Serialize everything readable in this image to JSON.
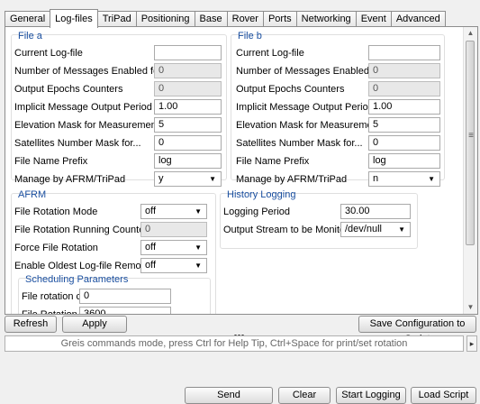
{
  "tabs": [
    "General",
    "Log-files",
    "TriPad",
    "Positioning",
    "Base",
    "Rover",
    "Ports",
    "Networking",
    "Event",
    "Advanced"
  ],
  "active_tab": "Log-files",
  "file_a": {
    "title": "File a",
    "rows": [
      {
        "label": "Current Log-file",
        "value": "",
        "kind": "field"
      },
      {
        "label": "Number of Messages Enabled for...",
        "value": "0",
        "kind": "ro"
      },
      {
        "label": "Output Epochs Counters",
        "value": "0",
        "kind": "ro"
      },
      {
        "label": "Implicit Message Output Period",
        "value": "1.00",
        "kind": "field"
      },
      {
        "label": "Elevation Mask for Measurements...",
        "value": "5",
        "kind": "field"
      },
      {
        "label": "Satellites Number Mask for...",
        "value": "0",
        "kind": "field"
      },
      {
        "label": "File Name Prefix",
        "value": "log",
        "kind": "field"
      },
      {
        "label": "Manage by AFRM/TriPad",
        "value": "y",
        "kind": "combo"
      }
    ]
  },
  "file_b": {
    "title": "File b",
    "rows": [
      {
        "label": "Current Log-file",
        "value": "",
        "kind": "field"
      },
      {
        "label": "Number of Messages Enabled for...",
        "value": "0",
        "kind": "ro"
      },
      {
        "label": "Output Epochs Counters",
        "value": "0",
        "kind": "ro"
      },
      {
        "label": "Implicit Message Output Period",
        "value": "1.00",
        "kind": "field"
      },
      {
        "label": "Elevation Mask for Measurements...",
        "value": "5",
        "kind": "field"
      },
      {
        "label": "Satellites Number Mask for...",
        "value": "0",
        "kind": "field"
      },
      {
        "label": "File Name Prefix",
        "value": "log",
        "kind": "field"
      },
      {
        "label": "Manage by AFRM/TriPad",
        "value": "n",
        "kind": "combo"
      }
    ]
  },
  "afrm": {
    "title": "AFRM",
    "rows": [
      {
        "label": "File Rotation Mode",
        "value": "off",
        "kind": "combo"
      },
      {
        "label": "File Rotation Running Counter",
        "value": "0",
        "kind": "ro"
      },
      {
        "label": "Force File Rotation",
        "value": "off",
        "kind": "combo"
      },
      {
        "label": "Enable Oldest Log-file Removal",
        "value": "off",
        "kind": "combo"
      }
    ],
    "scheduling": {
      "title": "Scheduling Parameters",
      "rows": [
        {
          "label": "File rotation counter",
          "value": "0"
        },
        {
          "label": "File Rotation Period",
          "value": "3600"
        }
      ]
    }
  },
  "history": {
    "title": "History Logging",
    "rows": [
      {
        "label": "Logging Period",
        "value": "30.00",
        "kind": "field"
      },
      {
        "label": "Output Stream to be Monitored",
        "value": "/dev/null",
        "kind": "combo"
      }
    ]
  },
  "buttons": {
    "refresh": "Refresh",
    "apply": "Apply",
    "save_config": "Save Configuration to Script",
    "send": "Send",
    "clear": "Clear",
    "start_logging": "Start Logging",
    "load_script": "Load Script"
  },
  "command_hint": "Greis commands mode, press Ctrl for Help Tip, Ctrl+Space for print/set rotation",
  "icons": {
    "combo_arrow": "▼",
    "scroll_up": "▲",
    "scroll_down": "▼",
    "grip": "≡",
    "side": "▸"
  }
}
